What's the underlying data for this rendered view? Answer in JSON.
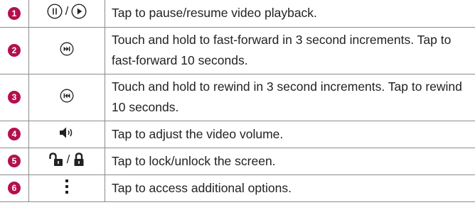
{
  "accent_color": "#b3104e",
  "rows": [
    {
      "number": "1",
      "icons": [
        "pause-icon",
        "play-icon"
      ],
      "separator": "/",
      "text": "Tap to pause/resume video playback."
    },
    {
      "number": "2",
      "icons": [
        "fast-forward-icon"
      ],
      "text": "Touch and hold to fast-forward in 3 second increments. Tap to fast-forward 10 seconds."
    },
    {
      "number": "3",
      "icons": [
        "rewind-icon"
      ],
      "text": "Touch and hold to rewind in 3 second increments. Tap to rewind 10 seconds."
    },
    {
      "number": "4",
      "icons": [
        "volume-icon"
      ],
      "text": "Tap to adjust the video volume."
    },
    {
      "number": "5",
      "icons": [
        "unlock-icon",
        "lock-icon"
      ],
      "separator": "/",
      "text": "Tap to lock/unlock the screen."
    },
    {
      "number": "6",
      "icons": [
        "more-options-icon"
      ],
      "text": "Tap to access additional options."
    }
  ]
}
